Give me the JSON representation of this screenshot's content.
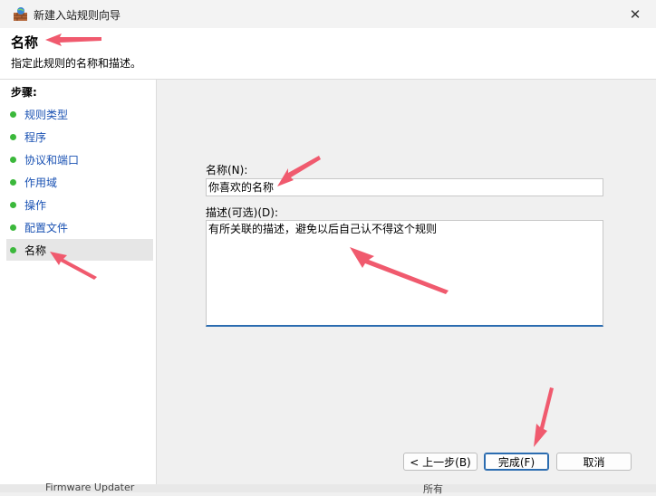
{
  "window": {
    "title": "新建入站规则向导",
    "close_glyph": "✕"
  },
  "header": {
    "title": "名称",
    "subtitle": "指定此规则的名称和描述。"
  },
  "steps": {
    "label": "步骤:",
    "items": [
      {
        "label": "规则类型"
      },
      {
        "label": "程序"
      },
      {
        "label": "协议和端口"
      },
      {
        "label": "作用域"
      },
      {
        "label": "操作"
      },
      {
        "label": "配置文件"
      },
      {
        "label": "名称"
      }
    ]
  },
  "form": {
    "name_label": "名称(N):",
    "name_value": "你喜欢的名称",
    "desc_label": "描述(可选)(D):",
    "desc_value": "有所关联的描述，避免以后自己认不得这个规则"
  },
  "buttons": {
    "back": "< 上一步(B)",
    "finish": "完成(F)",
    "cancel": "取消"
  },
  "colors": {
    "annotation_arrow": "#f05a6e",
    "step_dot": "#3bb83b",
    "link": "#1a52b3",
    "focus": "#2b6cb0"
  },
  "background_window": {
    "row_text": "Firmware Updater",
    "row_right": "所有"
  }
}
